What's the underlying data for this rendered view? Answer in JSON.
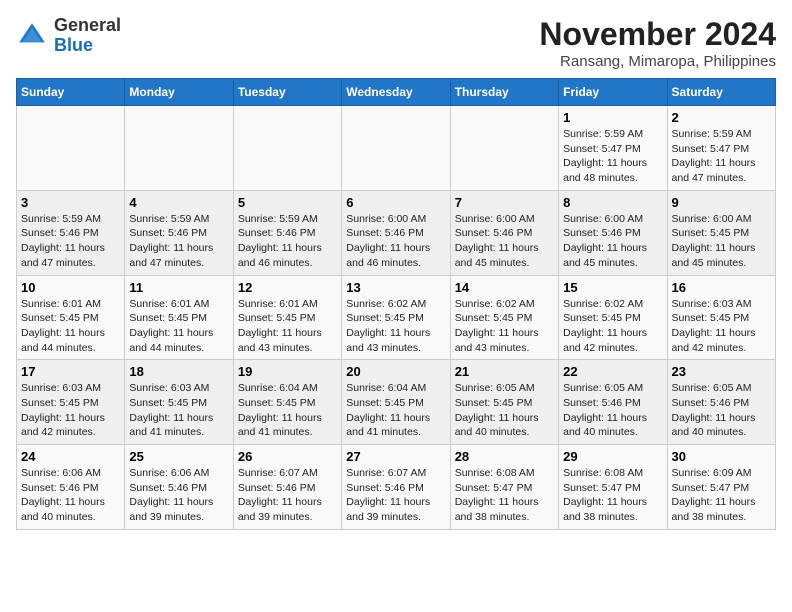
{
  "header": {
    "logo_general": "General",
    "logo_blue": "Blue",
    "month_year": "November 2024",
    "location": "Ransang, Mimaropa, Philippines"
  },
  "days_of_week": [
    "Sunday",
    "Monday",
    "Tuesday",
    "Wednesday",
    "Thursday",
    "Friday",
    "Saturday"
  ],
  "weeks": [
    [
      {
        "day": "",
        "info": ""
      },
      {
        "day": "",
        "info": ""
      },
      {
        "day": "",
        "info": ""
      },
      {
        "day": "",
        "info": ""
      },
      {
        "day": "",
        "info": ""
      },
      {
        "day": "1",
        "info": "Sunrise: 5:59 AM\nSunset: 5:47 PM\nDaylight: 11 hours and 48 minutes."
      },
      {
        "day": "2",
        "info": "Sunrise: 5:59 AM\nSunset: 5:47 PM\nDaylight: 11 hours and 47 minutes."
      }
    ],
    [
      {
        "day": "3",
        "info": "Sunrise: 5:59 AM\nSunset: 5:46 PM\nDaylight: 11 hours and 47 minutes."
      },
      {
        "day": "4",
        "info": "Sunrise: 5:59 AM\nSunset: 5:46 PM\nDaylight: 11 hours and 47 minutes."
      },
      {
        "day": "5",
        "info": "Sunrise: 5:59 AM\nSunset: 5:46 PM\nDaylight: 11 hours and 46 minutes."
      },
      {
        "day": "6",
        "info": "Sunrise: 6:00 AM\nSunset: 5:46 PM\nDaylight: 11 hours and 46 minutes."
      },
      {
        "day": "7",
        "info": "Sunrise: 6:00 AM\nSunset: 5:46 PM\nDaylight: 11 hours and 45 minutes."
      },
      {
        "day": "8",
        "info": "Sunrise: 6:00 AM\nSunset: 5:46 PM\nDaylight: 11 hours and 45 minutes."
      },
      {
        "day": "9",
        "info": "Sunrise: 6:00 AM\nSunset: 5:45 PM\nDaylight: 11 hours and 45 minutes."
      }
    ],
    [
      {
        "day": "10",
        "info": "Sunrise: 6:01 AM\nSunset: 5:45 PM\nDaylight: 11 hours and 44 minutes."
      },
      {
        "day": "11",
        "info": "Sunrise: 6:01 AM\nSunset: 5:45 PM\nDaylight: 11 hours and 44 minutes."
      },
      {
        "day": "12",
        "info": "Sunrise: 6:01 AM\nSunset: 5:45 PM\nDaylight: 11 hours and 43 minutes."
      },
      {
        "day": "13",
        "info": "Sunrise: 6:02 AM\nSunset: 5:45 PM\nDaylight: 11 hours and 43 minutes."
      },
      {
        "day": "14",
        "info": "Sunrise: 6:02 AM\nSunset: 5:45 PM\nDaylight: 11 hours and 43 minutes."
      },
      {
        "day": "15",
        "info": "Sunrise: 6:02 AM\nSunset: 5:45 PM\nDaylight: 11 hours and 42 minutes."
      },
      {
        "day": "16",
        "info": "Sunrise: 6:03 AM\nSunset: 5:45 PM\nDaylight: 11 hours and 42 minutes."
      }
    ],
    [
      {
        "day": "17",
        "info": "Sunrise: 6:03 AM\nSunset: 5:45 PM\nDaylight: 11 hours and 42 minutes."
      },
      {
        "day": "18",
        "info": "Sunrise: 6:03 AM\nSunset: 5:45 PM\nDaylight: 11 hours and 41 minutes."
      },
      {
        "day": "19",
        "info": "Sunrise: 6:04 AM\nSunset: 5:45 PM\nDaylight: 11 hours and 41 minutes."
      },
      {
        "day": "20",
        "info": "Sunrise: 6:04 AM\nSunset: 5:45 PM\nDaylight: 11 hours and 41 minutes."
      },
      {
        "day": "21",
        "info": "Sunrise: 6:05 AM\nSunset: 5:45 PM\nDaylight: 11 hours and 40 minutes."
      },
      {
        "day": "22",
        "info": "Sunrise: 6:05 AM\nSunset: 5:46 PM\nDaylight: 11 hours and 40 minutes."
      },
      {
        "day": "23",
        "info": "Sunrise: 6:05 AM\nSunset: 5:46 PM\nDaylight: 11 hours and 40 minutes."
      }
    ],
    [
      {
        "day": "24",
        "info": "Sunrise: 6:06 AM\nSunset: 5:46 PM\nDaylight: 11 hours and 40 minutes."
      },
      {
        "day": "25",
        "info": "Sunrise: 6:06 AM\nSunset: 5:46 PM\nDaylight: 11 hours and 39 minutes."
      },
      {
        "day": "26",
        "info": "Sunrise: 6:07 AM\nSunset: 5:46 PM\nDaylight: 11 hours and 39 minutes."
      },
      {
        "day": "27",
        "info": "Sunrise: 6:07 AM\nSunset: 5:46 PM\nDaylight: 11 hours and 39 minutes."
      },
      {
        "day": "28",
        "info": "Sunrise: 6:08 AM\nSunset: 5:47 PM\nDaylight: 11 hours and 38 minutes."
      },
      {
        "day": "29",
        "info": "Sunrise: 6:08 AM\nSunset: 5:47 PM\nDaylight: 11 hours and 38 minutes."
      },
      {
        "day": "30",
        "info": "Sunrise: 6:09 AM\nSunset: 5:47 PM\nDaylight: 11 hours and 38 minutes."
      }
    ]
  ]
}
